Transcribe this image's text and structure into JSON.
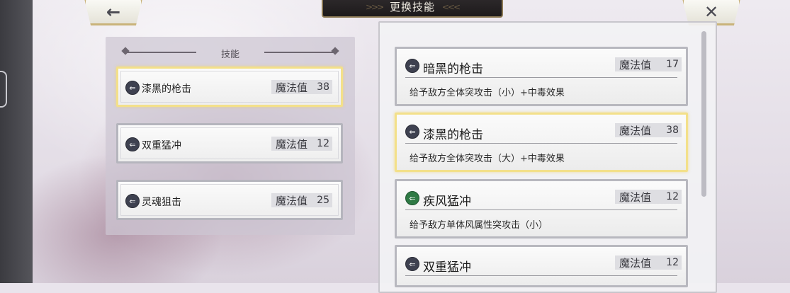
{
  "header": {
    "title": "更换技能",
    "back_icon": "←",
    "close_icon": "✕"
  },
  "left_panel": {
    "heading": "技能",
    "slots": [
      {
        "name": "漆黑的枪击",
        "mp_label": "魔法值",
        "mp": "38",
        "selected": true
      },
      {
        "name": "双重猛冲",
        "mp_label": "魔法值",
        "mp": "12",
        "selected": false
      },
      {
        "name": "灵魂狙击",
        "mp_label": "魔法值",
        "mp": "25",
        "selected": false
      }
    ]
  },
  "skill_list": [
    {
      "name": "暗黑的枪击",
      "mp_label": "魔法值",
      "mp": "17",
      "desc": "给予敌方全体突攻击（小）+中毒效果",
      "icon": "dark-arrow-icon"
    },
    {
      "name": "漆黑的枪击",
      "mp_label": "魔法值",
      "mp": "38",
      "desc": "给予敌方全体突攻击（大）+中毒效果",
      "icon": "dark-arrow-icon"
    },
    {
      "name": "疾风猛冲",
      "mp_label": "魔法值",
      "mp": "12",
      "desc": "给予敌方单体风属性突攻击（小）",
      "icon": "wind-arrow-icon"
    },
    {
      "name": "双重猛冲",
      "mp_label": "魔法值",
      "mp": "12",
      "desc": "",
      "icon": "dark-arrow-icon"
    }
  ],
  "colors": {
    "selected_border": "#f3e08a",
    "wind_icon": "#2f7a45",
    "dark_icon": "#3e4150"
  }
}
